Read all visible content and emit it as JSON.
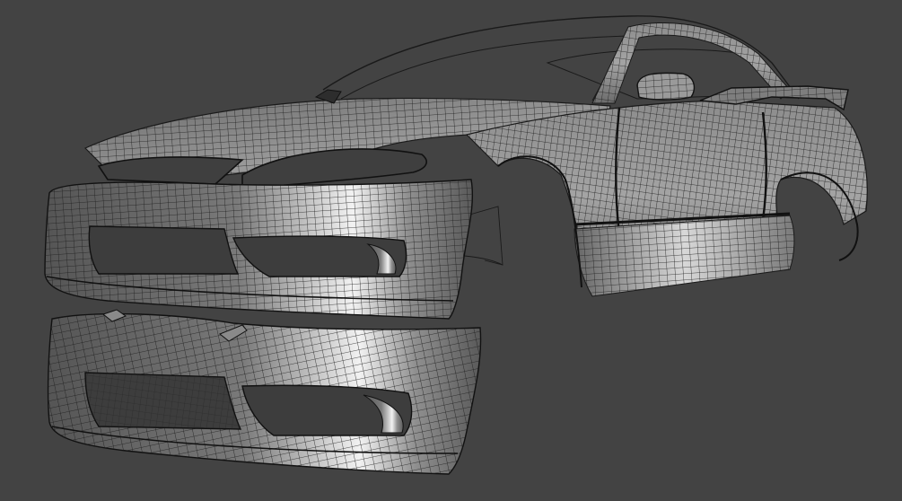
{
  "viewport": {
    "background": "#434343",
    "shading": "wireframe-on-shaded",
    "wire_color": "#1c1c1c",
    "surface_dark": "#4a4a4a",
    "surface_mid": "#8a8a8a",
    "surface_light": "#efefef",
    "hole_color": "#3a3a3a"
  },
  "scene_objects": [
    {
      "name": "car-body"
    },
    {
      "name": "front-bumper-attached"
    },
    {
      "name": "front-bumper-detached"
    },
    {
      "name": "rear-spoiler"
    },
    {
      "name": "side-mirror"
    }
  ]
}
